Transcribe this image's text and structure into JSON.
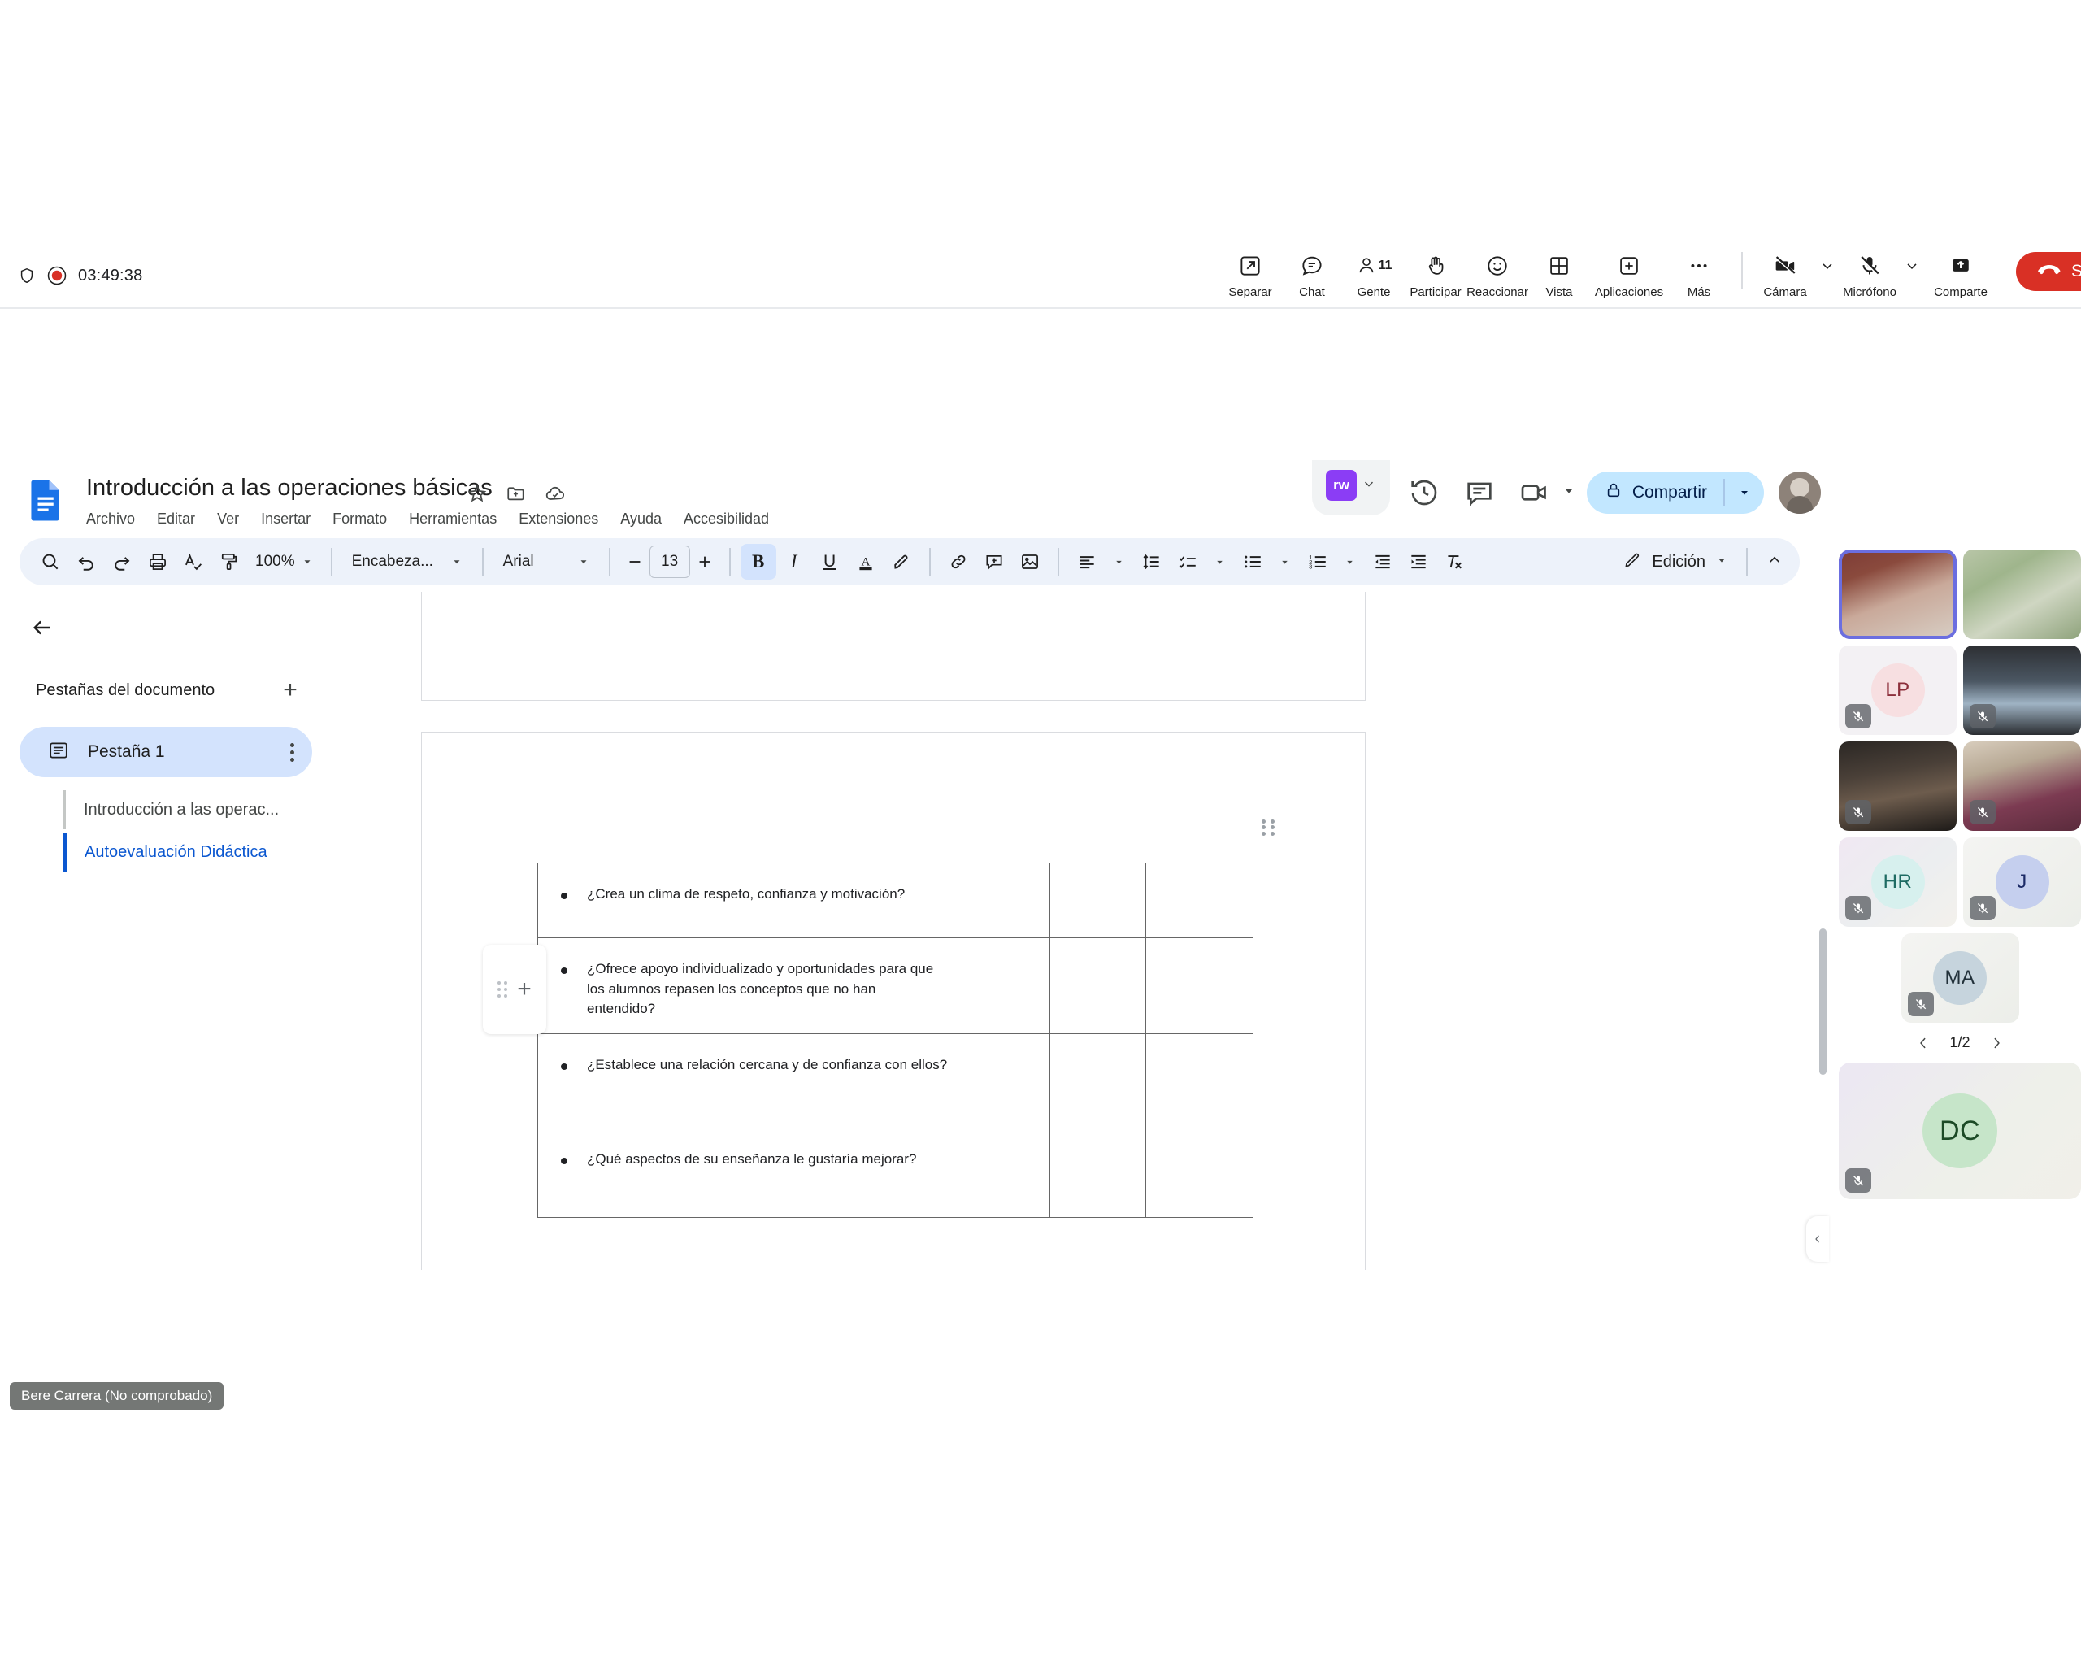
{
  "meet": {
    "timer": "03:49:38",
    "controls": [
      {
        "id": "separar",
        "label": "Separar",
        "icon": "open-in-new-icon"
      },
      {
        "id": "chat",
        "label": "Chat",
        "icon": "chat-bubble-icon"
      },
      {
        "id": "gente",
        "label": "Gente",
        "icon": "person-icon",
        "count": "11"
      },
      {
        "id": "participar",
        "label": "Participar",
        "icon": "raise-hand-icon"
      },
      {
        "id": "reaccionar",
        "label": "Reaccionar",
        "icon": "smiley-face-icon"
      },
      {
        "id": "vista",
        "label": "Vista",
        "icon": "grid-layout-icon"
      },
      {
        "id": "aplicaciones",
        "label": "Aplicaciones",
        "icon": "plus-box-icon"
      },
      {
        "id": "mas",
        "label": "Más",
        "icon": "more-horizontal-icon"
      }
    ],
    "devices": [
      {
        "id": "camara",
        "label": "Cámara",
        "icon": "camera-off-icon",
        "state": "off"
      },
      {
        "id": "microfono",
        "label": "Micrófono",
        "icon": "mic-off-icon",
        "state": "off"
      },
      {
        "id": "comparte",
        "label": "Comparte",
        "icon": "share-screen-icon",
        "state": "idle"
      }
    ],
    "leave_label": "Salir",
    "tooltip": "Bere Carrera (No comprobado)",
    "pager": {
      "value": "1/2"
    },
    "participants": [
      {
        "id": "p1",
        "type": "video",
        "style": "v1",
        "muted": false,
        "active": true
      },
      {
        "id": "p2",
        "type": "video",
        "style": "v2",
        "muted": false,
        "active": false
      },
      {
        "id": "p3",
        "type": "avatar",
        "initials": "LP",
        "bg": "#f7dfe1",
        "fg": "#8c2f3b",
        "tilebg": "vblank",
        "muted": true
      },
      {
        "id": "p4",
        "type": "video",
        "style": "v3",
        "muted": true
      },
      {
        "id": "p5",
        "type": "video",
        "style": "v4",
        "muted": true
      },
      {
        "id": "p6",
        "type": "video",
        "style": "v5",
        "muted": true
      },
      {
        "id": "p7",
        "type": "avatar",
        "initials": "HR",
        "bg": "#d7f0ee",
        "fg": "#1e6b63",
        "tilebg": "vlav",
        "muted": true
      },
      {
        "id": "p8",
        "type": "avatar",
        "initials": "J",
        "bg": "#c5cfee",
        "fg": "#1b2a66",
        "tilebg": "vgray",
        "muted": true
      },
      {
        "id": "p9",
        "type": "avatar",
        "initials": "MA",
        "bg": "#c6d4dd",
        "fg": "#22313a",
        "tilebg": "vgray",
        "muted": true,
        "solo": true
      }
    ],
    "spotlight": {
      "initials": "DC",
      "bg": "#c6e5c9",
      "fg": "#1c4a26",
      "muted": true
    }
  },
  "docs": {
    "title": "Introducción a las operaciones básicas",
    "title_icons": [
      "star-icon",
      "move-to-folder-icon",
      "cloud-saved-icon"
    ],
    "menu": [
      "Archivo",
      "Editar",
      "Ver",
      "Insertar",
      "Formato",
      "Herramientas",
      "Extensiones",
      "Ayuda",
      "Accesibilidad"
    ],
    "header_right": {
      "addon_label": "rw",
      "history_icon": "version-history-icon",
      "comment_icon": "comment-icon",
      "meet_icon": "meet-camera-icon",
      "share_label": "Compartir",
      "lock_icon": "lock-icon"
    },
    "toolbar": {
      "zoom": "100%",
      "style": "Encabeza...",
      "font": "Arial",
      "font_size": "13",
      "mode_label": "Edición",
      "icons": [
        "search-icon",
        "undo-icon",
        "redo-icon",
        "print-icon",
        "spellcheck-icon",
        "paint-format-icon",
        "bold-icon",
        "italic-icon",
        "underline-icon",
        "text-color-icon",
        "highlight-icon",
        "link-icon",
        "add-comment-icon",
        "insert-image-icon",
        "align-icon",
        "line-spacing-icon",
        "checklist-icon",
        "bulleted-list-icon",
        "numbered-list-icon",
        "decrease-indent-icon",
        "increase-indent-icon",
        "clear-formatting-icon"
      ]
    },
    "sidebar": {
      "back_icon": "back-arrow-icon",
      "header": "Pestañas del documento",
      "add_icon": "plus-icon",
      "tab": {
        "label": "Pestaña 1",
        "icon": "doc-tab-icon",
        "kebab": "more-vertical-icon"
      },
      "subitems": [
        {
          "label": "Introducción a las operac...",
          "active": false
        },
        {
          "label": "Autoevaluación Didáctica",
          "active": true
        }
      ]
    },
    "table": {
      "rows": [
        {
          "question": "¿Crea un clima de respeto, confianza y motivación?",
          "col2": "",
          "col3": ""
        },
        {
          "question": "¿Ofrece apoyo individualizado y oportunidades para que los alumnos repasen los conceptos que no han entendido?",
          "col2": "",
          "col3": ""
        },
        {
          "question": "¿Establece una relación cercana y de confianza con ellos?",
          "col2": "",
          "col3": ""
        },
        {
          "question": "¿Qué aspectos de su enseñanza le gustaría mejorar?",
          "col2": "",
          "col3": ""
        }
      ]
    }
  }
}
